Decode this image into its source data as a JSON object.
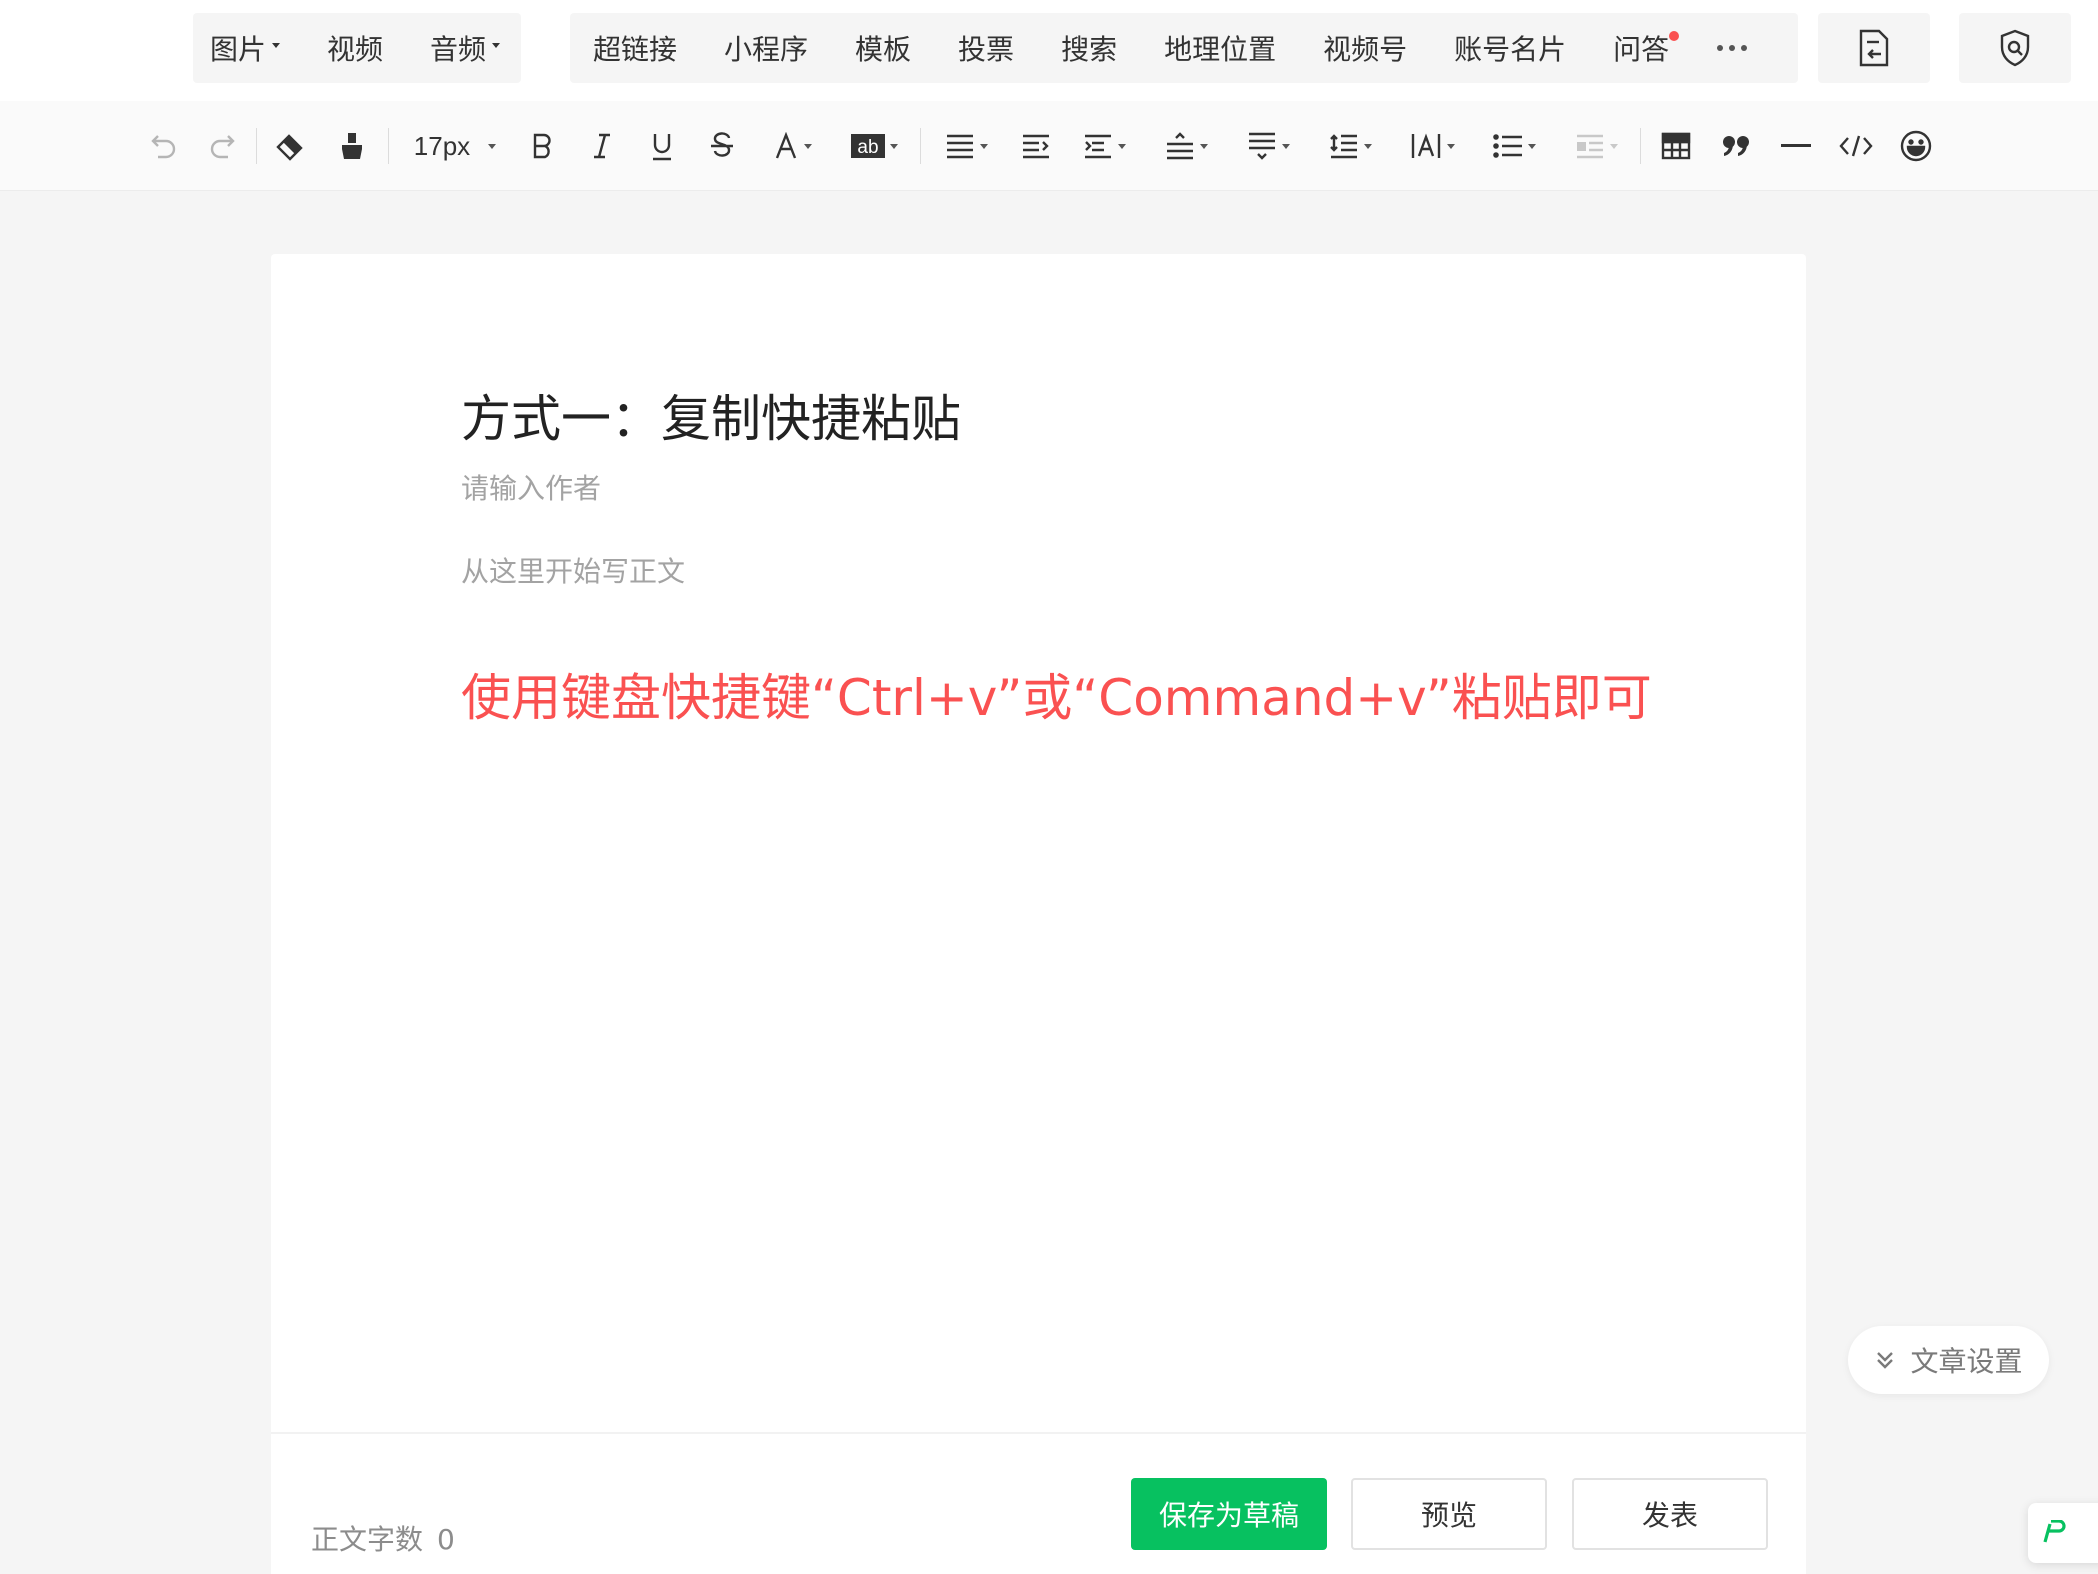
{
  "insert_bar": {
    "group1": [
      {
        "label": "图片",
        "has_dropdown": true
      },
      {
        "label": "视频",
        "has_dropdown": false
      },
      {
        "label": "音频",
        "has_dropdown": true
      }
    ],
    "group2": [
      "超链接",
      "小程序",
      "模板",
      "投票",
      "搜索",
      "地理位置",
      "视频号",
      "账号名片",
      "问答"
    ],
    "qa_has_notification": true,
    "more_icon": "more-dots-icon",
    "right_icons": [
      "import-doc-icon",
      "shield-icon"
    ]
  },
  "format_toolbar": {
    "font_size": "17px",
    "icons": [
      "undo-icon",
      "redo-icon",
      "eraser-icon",
      "format-painter-icon",
      "font-size-select",
      "bold-icon",
      "italic-icon",
      "underline-icon",
      "strikethrough-icon",
      "font-color-icon",
      "highlight-icon",
      "align-icon",
      "indent-icon",
      "paragraph-spacing-icon",
      "line-spacing-before-icon",
      "line-spacing-after-icon",
      "line-height-icon",
      "letter-spacing-icon",
      "list-icon",
      "float-icon",
      "table-icon",
      "quote-icon",
      "divider-icon",
      "code-icon",
      "emoji-icon"
    ]
  },
  "editor": {
    "title": "方式一：复制快捷粘贴",
    "author_placeholder": "请输入作者",
    "body_placeholder": "从这里开始写正文",
    "instruction_text": "使用键盘快捷键“Ctrl+v”或“Command+v”粘贴即可",
    "instruction_color": "#fa5151"
  },
  "footer": {
    "word_count_label": "正文字数",
    "word_count_value": "0",
    "save_draft": "保存为草稿",
    "preview": "预览",
    "publish": "发表"
  },
  "article_settings": "文章设置",
  "colors": {
    "accent_green": "#07c160",
    "notification_red": "#fa5151",
    "placeholder_gray": "#a3a3a3"
  }
}
